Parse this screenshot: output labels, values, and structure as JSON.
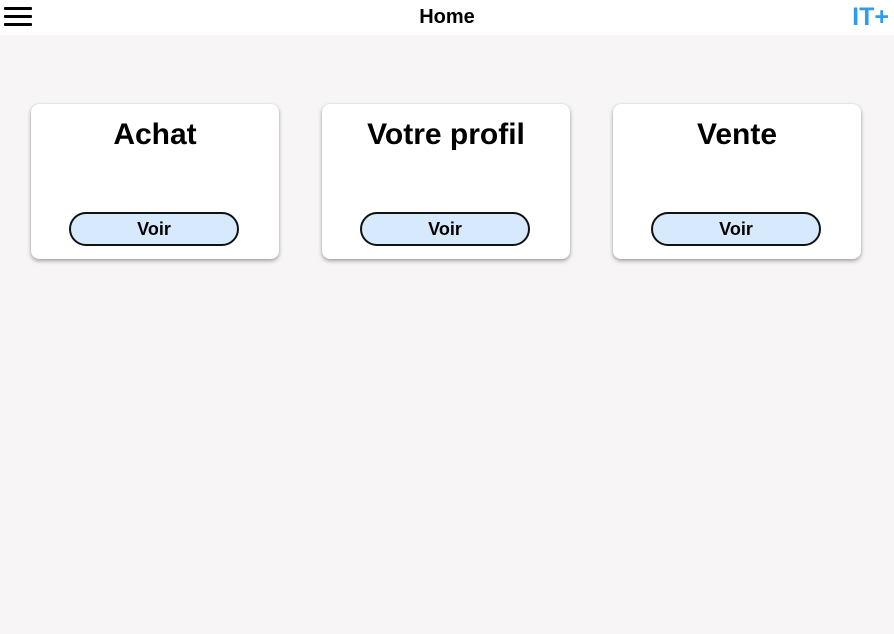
{
  "header": {
    "title": "Home",
    "brand": "IT+",
    "menu_icon": "hamburger-menu-icon",
    "brand_color": "#2f9bef"
  },
  "cards": [
    {
      "title": "Achat",
      "button_label": "Voir"
    },
    {
      "title": "Votre profil",
      "button_label": "Voir"
    },
    {
      "title": "Vente",
      "button_label": "Voir"
    }
  ],
  "colors": {
    "background": "#f7f5f6",
    "button_fill": "#d6e9fd"
  }
}
